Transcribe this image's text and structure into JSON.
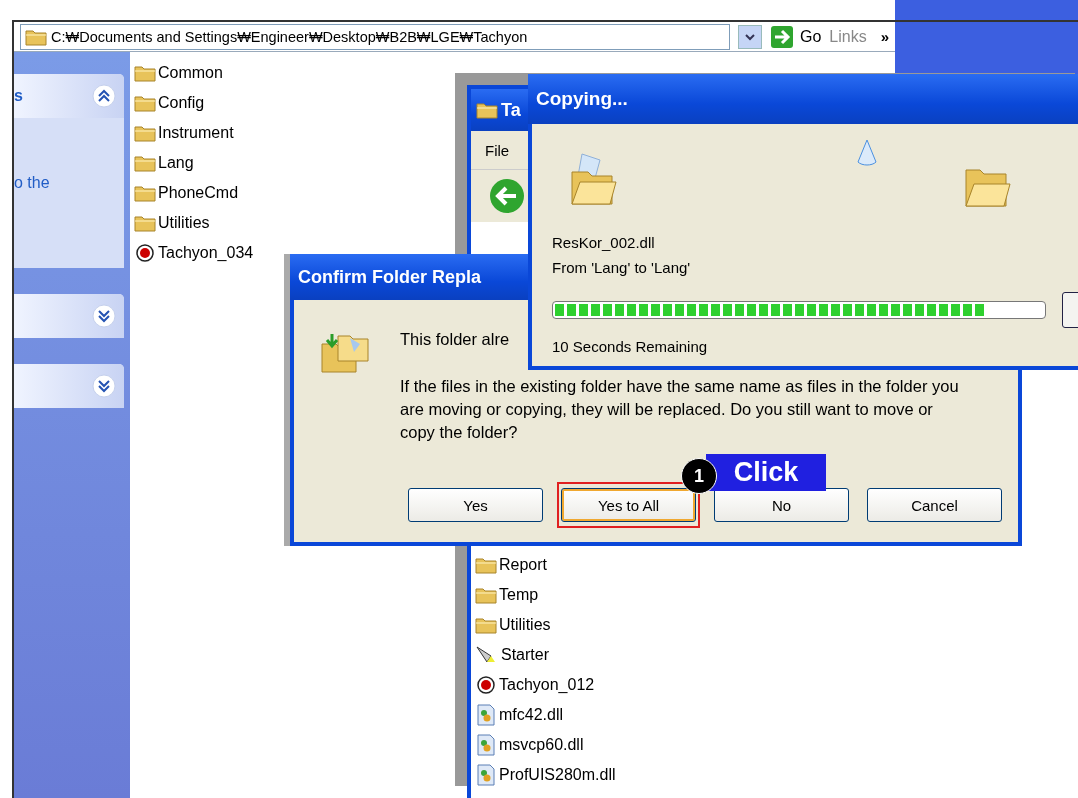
{
  "address_bar": {
    "path": "C:₩Documents and Settings₩Engineer₩Desktop₩B2B₩LGE₩Tachyon",
    "go": "Go",
    "links": "Links",
    "more": "»"
  },
  "task_pane": {
    "panels": [
      {
        "title": "s",
        "expanded": true,
        "link": "o the"
      },
      {
        "expanded": false
      },
      {
        "expanded": false
      }
    ]
  },
  "file_list": [
    {
      "name": "Common",
      "kind": "folder"
    },
    {
      "name": "Config",
      "kind": "folder"
    },
    {
      "name": "Instrument",
      "kind": "folder"
    },
    {
      "name": "Lang",
      "kind": "folder"
    },
    {
      "name": "PhoneCmd",
      "kind": "folder"
    },
    {
      "name": "Utilities",
      "kind": "folder"
    },
    {
      "name": "Tachyon_034",
      "kind": "app"
    }
  ],
  "explorer_window": {
    "title": "Ta",
    "menu": [
      "File"
    ],
    "files": [
      {
        "name": "Report",
        "kind": "folder"
      },
      {
        "name": "Temp",
        "kind": "folder"
      },
      {
        "name": "Utilities",
        "kind": "folder"
      },
      {
        "name": "Starter",
        "kind": "shortcut"
      },
      {
        "name": "Tachyon_012",
        "kind": "app"
      },
      {
        "name": "mfc42.dll",
        "kind": "dll"
      },
      {
        "name": "msvcp60.dll",
        "kind": "dll"
      },
      {
        "name": "ProfUIS280m.dll",
        "kind": "dll"
      }
    ]
  },
  "copy_dialog": {
    "title": "Copying...",
    "file": "ResKor_002.dll",
    "from_to": "From 'Lang' to 'Lang'",
    "level": 0.88,
    "remaining": "10 Seconds Remaining"
  },
  "confirm_dialog": {
    "title": "Confirm Folder Repla",
    "message": "This folder alre",
    "detail": "If the files in the existing folder have the same name as files in the folder you are moving or copying, they will be replaced.  Do you still want to move or copy the folder?",
    "buttons": [
      {
        "label": "Yes",
        "highlighted": false
      },
      {
        "label": "Yes to All",
        "highlighted": true
      },
      {
        "label": "No",
        "highlighted": false
      },
      {
        "label": "Cancel",
        "highlighted": false
      }
    ]
  },
  "annotation": {
    "step": "1",
    "label": "Click"
  }
}
